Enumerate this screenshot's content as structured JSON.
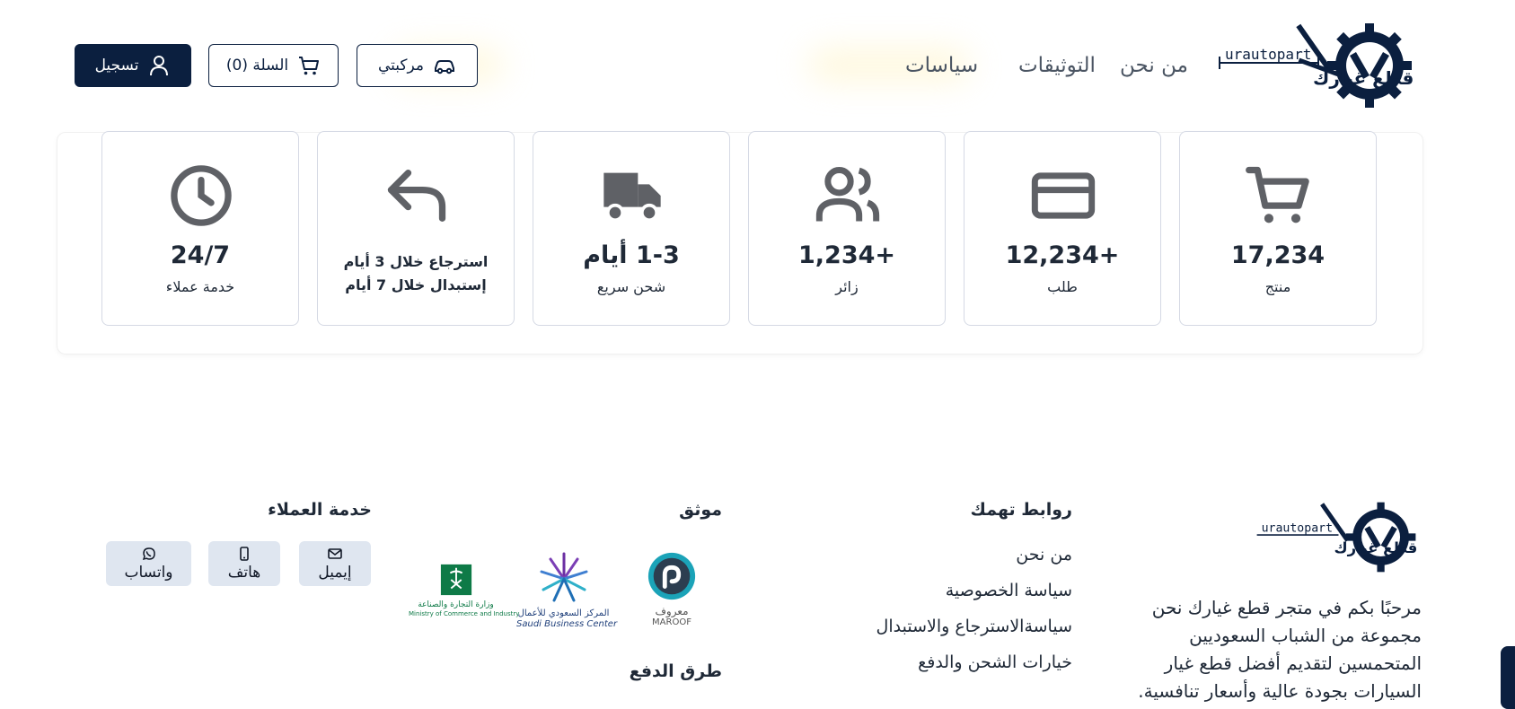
{
  "header": {
    "brand_latin": "urautopart",
    "brand_arabic": "قطع غيارك",
    "nav": [
      "من نحن",
      "التوثيقات",
      "سياسات"
    ],
    "garage_label": "مركبتي",
    "cart_label": "السلة (0)",
    "register_label": "تسجيل"
  },
  "stats": [
    {
      "icon": "cart-icon",
      "value": "17,234",
      "label": "منتج"
    },
    {
      "icon": "credit-card-icon",
      "value": "12,234+",
      "label": "طلب"
    },
    {
      "icon": "users-icon",
      "value": "1,234+",
      "label": "زائر"
    },
    {
      "icon": "truck-icon",
      "value": "1-3 أيام",
      "label": "شحن سريع"
    },
    {
      "icon": "return-icon",
      "line1": "استرجاع خلال 3 أيام",
      "line2": "إستبدال خلال 7 أيام"
    },
    {
      "icon": "clock-icon",
      "value": "24/7",
      "label": "خدمة عملاء"
    }
  ],
  "footer": {
    "brand_latin": "urautopart",
    "brand_arabic": "قطع غيارك",
    "about": "مرحبًا بكم في متجر قطع غيارك نحن مجموعة من الشباب السعوديين المتحمسين لتقديم أفضل قطع غيار السيارات بجودة عالية وأسعار تنافسية.",
    "links_title": "روابط تهمك",
    "links": [
      "من نحن",
      "سياسة الخصوصية",
      "سياسةالاسترجاع والاستبدال",
      "خيارات الشحن والدفع"
    ],
    "trusted_title": "موثق",
    "maroof_ar": "معروف",
    "maroof_en": "MAROOF",
    "sbc_ar": "المركز السعودي للأعمال",
    "sbc_en": "Saudi Business Center",
    "moci_ar": "وزارة التجارة والصناعة",
    "moci_en": "Ministry of Commerce and Industry",
    "payment_title": "طرق الدفع",
    "support_title": "خدمة العملاء",
    "support": [
      {
        "icon": "mail-icon",
        "label": "إيميل"
      },
      {
        "icon": "phone-icon",
        "label": "هاتف"
      },
      {
        "icon": "whatsapp-icon",
        "label": "واتساب"
      }
    ]
  },
  "colors": {
    "navy": "#0b1f3f",
    "icon_gray": "#5f6166",
    "card_border": "#d5d9e4",
    "button_gray": "#dfe6f0"
  }
}
